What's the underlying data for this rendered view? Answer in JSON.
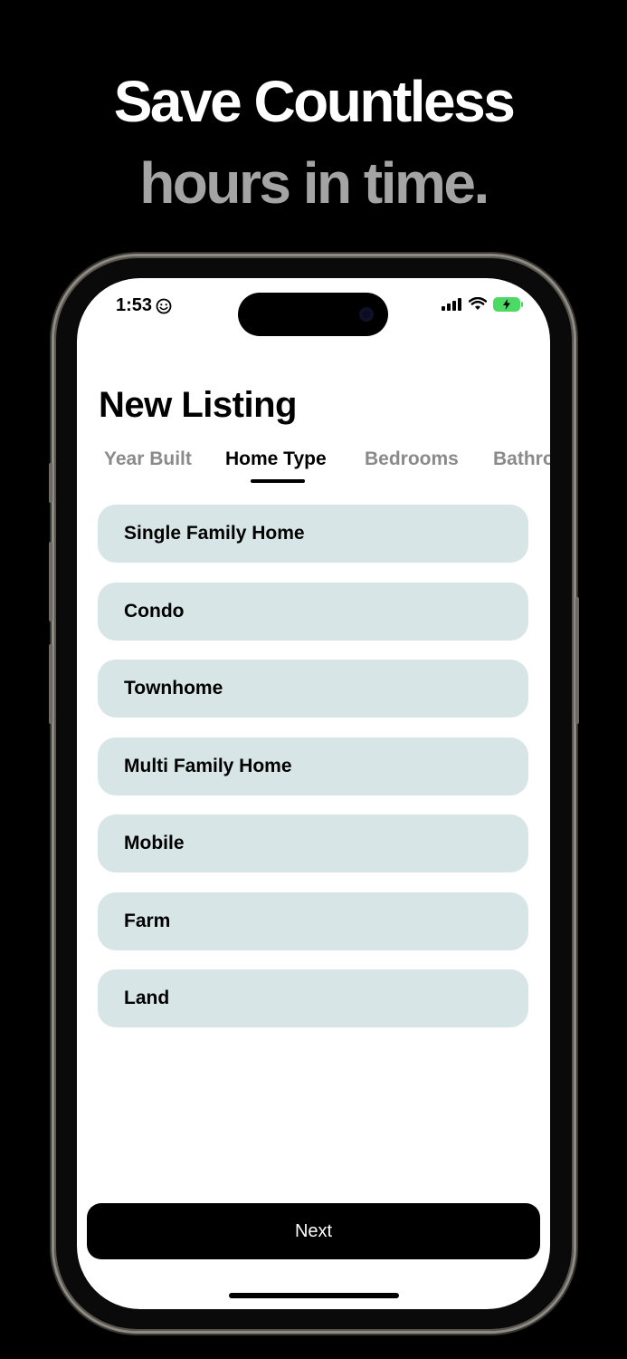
{
  "headline": {
    "line1": "Save Countless",
    "line2": "hours in time."
  },
  "status_bar": {
    "time": "1:53",
    "time_icon": "smiley-icon",
    "signal_icon": "cellular-signal-icon",
    "wifi_icon": "wifi-icon",
    "battery_icon": "battery-charging-icon",
    "battery_color": "#4cd964"
  },
  "page": {
    "title": "New Listing"
  },
  "tabs": [
    {
      "label": "Year Built",
      "active": false
    },
    {
      "label": "Home Type",
      "active": true
    },
    {
      "label": "Bedrooms",
      "active": false
    },
    {
      "label": "Bathrooms",
      "active": false
    }
  ],
  "options": [
    {
      "label": "Single Family Home"
    },
    {
      "label": "Condo"
    },
    {
      "label": "Townhome"
    },
    {
      "label": "Multi Family Home"
    },
    {
      "label": "Mobile"
    },
    {
      "label": "Farm"
    },
    {
      "label": "Land"
    }
  ],
  "colors": {
    "option_bg": "#d8e5e6",
    "headline_secondary": "#a4a4a4",
    "tab_inactive": "#8a8a8a"
  },
  "next_button": {
    "label": "Next"
  }
}
